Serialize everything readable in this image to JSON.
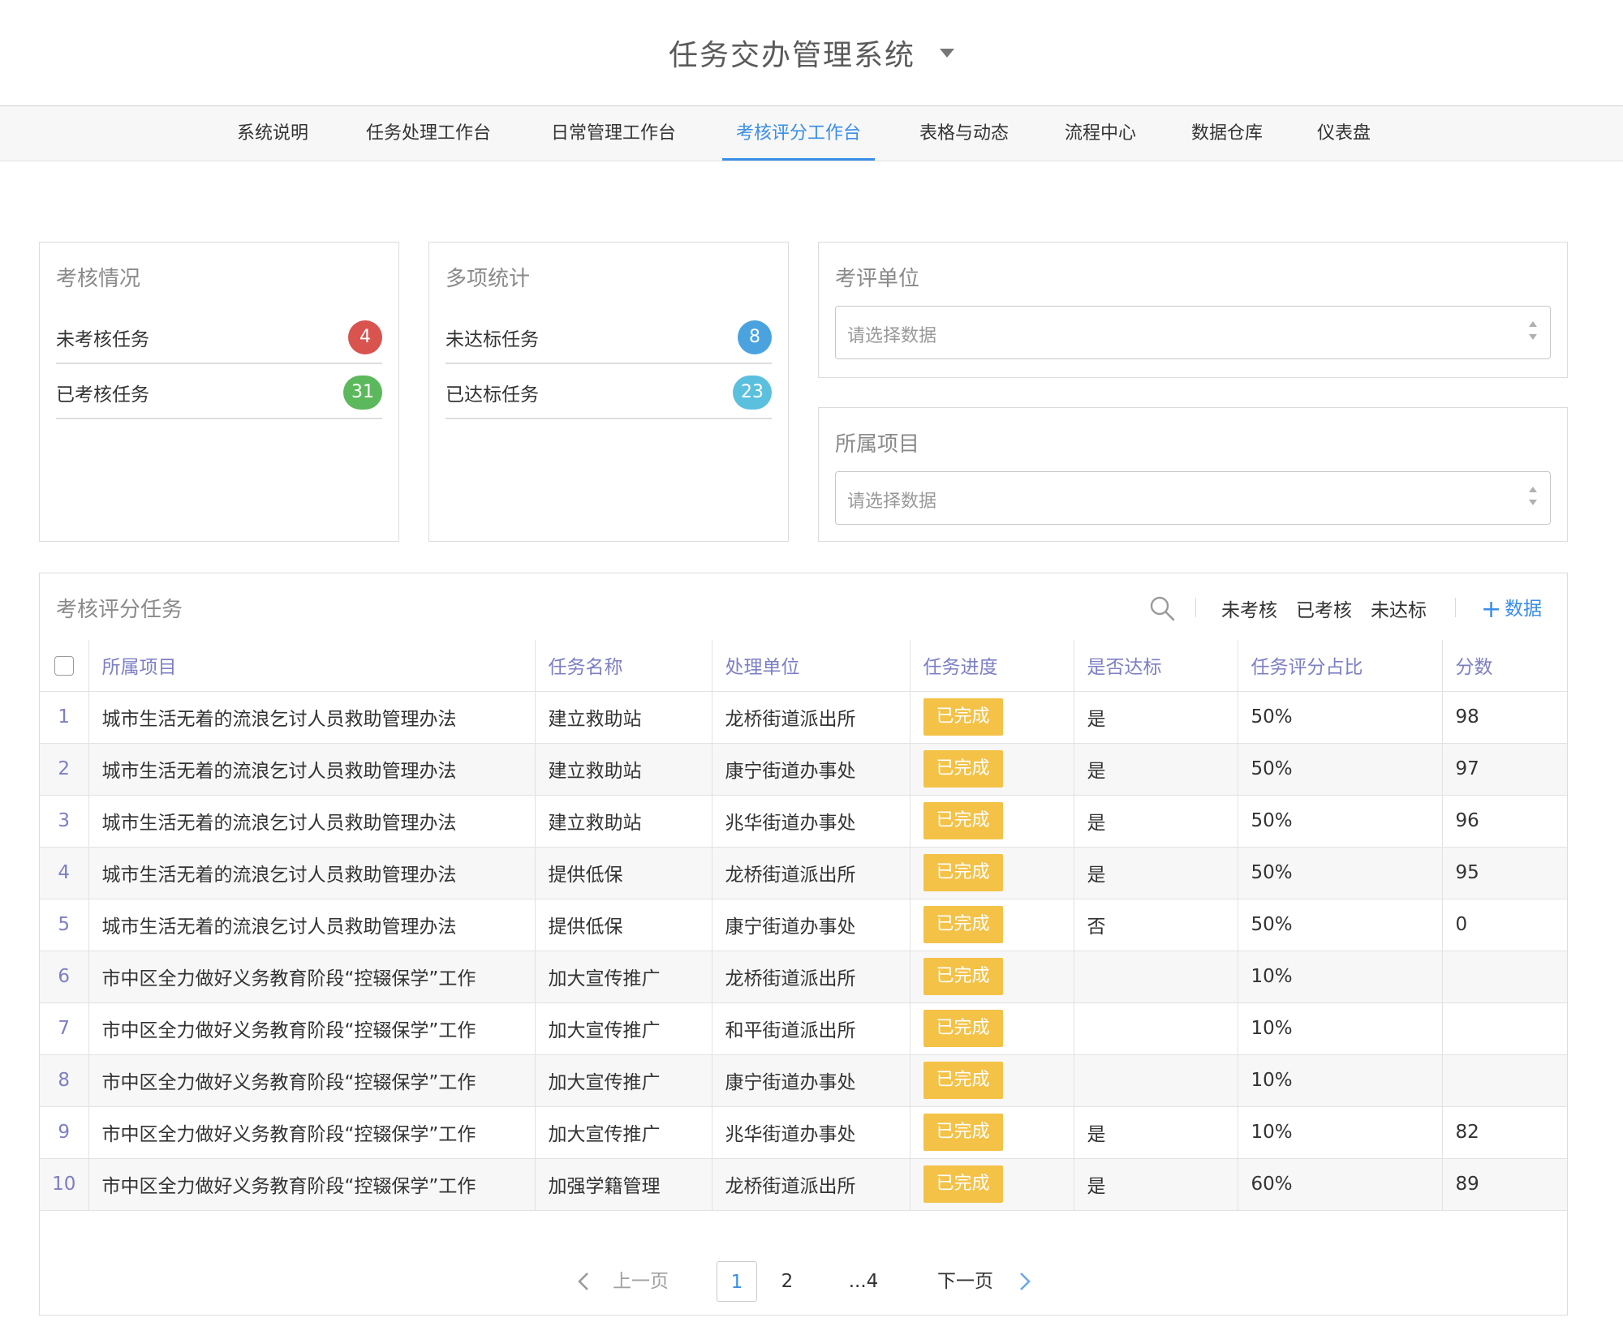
{
  "app": {
    "title": "任务交办管理系统"
  },
  "nav": {
    "items": [
      {
        "label": "系统说明"
      },
      {
        "label": "任务处理工作台"
      },
      {
        "label": "日常管理工作台"
      },
      {
        "label": "考核评分工作台",
        "active": true
      },
      {
        "label": "表格与动态"
      },
      {
        "label": "流程中心"
      },
      {
        "label": "数据仓库"
      },
      {
        "label": "仪表盘"
      }
    ]
  },
  "assessment": {
    "title": "考核情况",
    "rows": [
      {
        "label": "未考核任务",
        "count": "4",
        "color": "#d9534f"
      },
      {
        "label": "已考核任务",
        "count": "31",
        "color": "#5cb85c"
      }
    ]
  },
  "stats": {
    "title": "多项统计",
    "rows": [
      {
        "label": "未达标任务",
        "count": "8",
        "color": "#4aa3df"
      },
      {
        "label": "已达标任务",
        "count": "23",
        "color": "#5bc0de"
      }
    ]
  },
  "filters": {
    "unit": {
      "title": "考评单位",
      "placeholder": "请选择数据"
    },
    "project": {
      "title": "所属项目",
      "placeholder": "请选择数据"
    }
  },
  "tasks": {
    "title": "考核评分任务",
    "toolbar": {
      "filters": [
        "未考核",
        "已考核",
        "未达标"
      ],
      "add_label": "数据"
    },
    "columns": [
      "所属项目",
      "任务名称",
      "处理单位",
      "任务进度",
      "是否达标",
      "任务评分占比",
      "分数"
    ],
    "rows": [
      {
        "no": "1",
        "project": "城市生活无着的流浪乞讨人员救助管理办法",
        "task": "建立救助站",
        "unit": "龙桥街道派出所",
        "progress": "已完成",
        "qualified": "是",
        "ratio": "50%",
        "score": "98"
      },
      {
        "no": "2",
        "project": "城市生活无着的流浪乞讨人员救助管理办法",
        "task": "建立救助站",
        "unit": "康宁街道办事处",
        "progress": "已完成",
        "qualified": "是",
        "ratio": "50%",
        "score": "97"
      },
      {
        "no": "3",
        "project": "城市生活无着的流浪乞讨人员救助管理办法",
        "task": "建立救助站",
        "unit": "兆华街道办事处",
        "progress": "已完成",
        "qualified": "是",
        "ratio": "50%",
        "score": "96"
      },
      {
        "no": "4",
        "project": "城市生活无着的流浪乞讨人员救助管理办法",
        "task": "提供低保",
        "unit": "龙桥街道派出所",
        "progress": "已完成",
        "qualified": "是",
        "ratio": "50%",
        "score": "95"
      },
      {
        "no": "5",
        "project": "城市生活无着的流浪乞讨人员救助管理办法",
        "task": "提供低保",
        "unit": "康宁街道办事处",
        "progress": "已完成",
        "qualified": "否",
        "ratio": "50%",
        "score": "0"
      },
      {
        "no": "6",
        "project": "市中区全力做好义务教育阶段“控辍保学”工作",
        "task": "加大宣传推广",
        "unit": "龙桥街道派出所",
        "progress": "已完成",
        "qualified": "",
        "ratio": "10%",
        "score": ""
      },
      {
        "no": "7",
        "project": "市中区全力做好义务教育阶段“控辍保学”工作",
        "task": "加大宣传推广",
        "unit": "和平街道派出所",
        "progress": "已完成",
        "qualified": "",
        "ratio": "10%",
        "score": ""
      },
      {
        "no": "8",
        "project": "市中区全力做好义务教育阶段“控辍保学”工作",
        "task": "加大宣传推广",
        "unit": "康宁街道办事处",
        "progress": "已完成",
        "qualified": "",
        "ratio": "10%",
        "score": ""
      },
      {
        "no": "9",
        "project": "市中区全力做好义务教育阶段“控辍保学”工作",
        "task": "加大宣传推广",
        "unit": "兆华街道办事处",
        "progress": "已完成",
        "qualified": "是",
        "ratio": "10%",
        "score": "82"
      },
      {
        "no": "10",
        "project": "市中区全力做好义务教育阶段“控辍保学”工作",
        "task": "加强学籍管理",
        "unit": "龙桥街道派出所",
        "progress": "已完成",
        "qualified": "是",
        "ratio": "60%",
        "score": "89"
      }
    ]
  },
  "pagination": {
    "prev_label": "上一页",
    "next_label": "下一页",
    "pages": [
      "1",
      "2",
      "...4"
    ],
    "current": "1"
  }
}
